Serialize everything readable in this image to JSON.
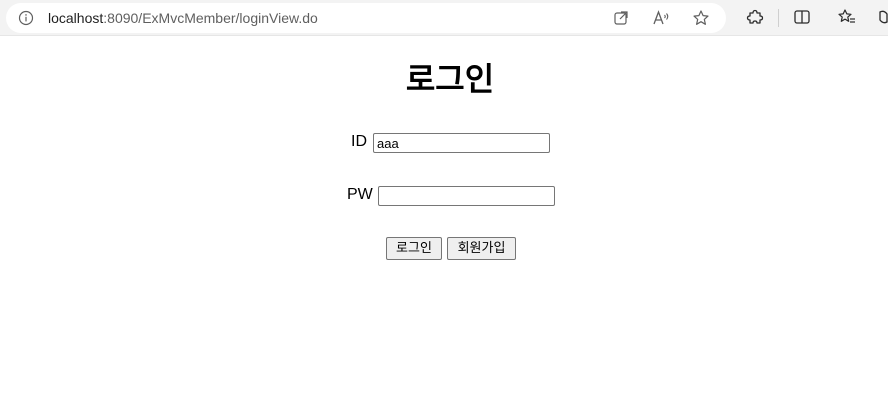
{
  "browser": {
    "url_host": "localhost",
    "url_rest": ":8090/ExMvcMember/loginView.do"
  },
  "page": {
    "title": "로그인",
    "id_label": "ID",
    "id_value": "aaa",
    "pw_label": "PW",
    "pw_value": "",
    "login_button": "로그인",
    "signup_button": "회원가입"
  },
  "icons": {
    "site_info": "info-icon",
    "open_in_app": "open-external-icon",
    "read_aloud": "read-aloud-icon",
    "favorite": "star-icon",
    "extensions": "puzzle-icon",
    "split_screen": "split-screen-icon",
    "favorites_bar": "favorites-icon",
    "copilot": "copilot-icon"
  }
}
